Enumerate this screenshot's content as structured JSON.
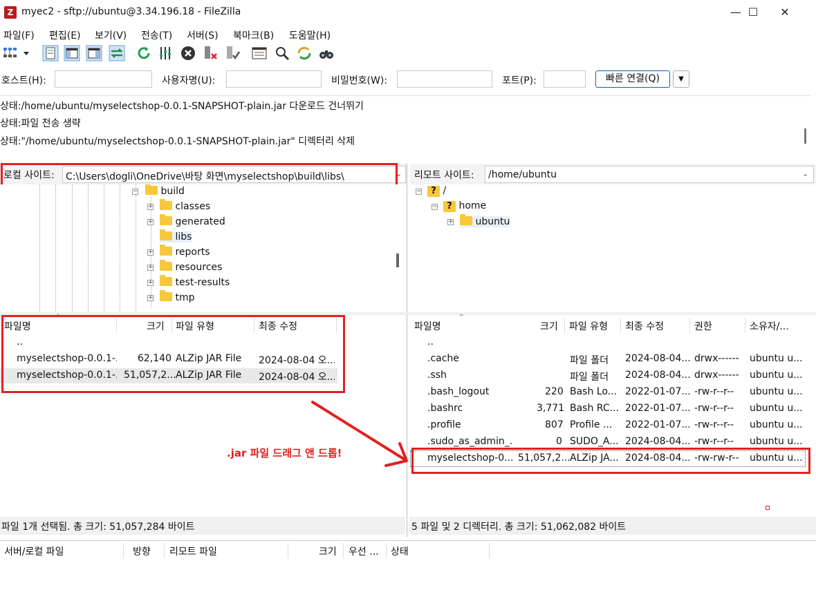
{
  "window": {
    "title": "myec2 - sftp://ubuntu@3.34.196.18 - FileZilla",
    "minimize": "—",
    "maximize": "☐",
    "close": "✕"
  },
  "menu": [
    "파일(F)",
    "편집(E)",
    "보기(V)",
    "전송(T)",
    "서버(S)",
    "북마크(B)",
    "도움말(H)"
  ],
  "quickconnect": {
    "host_label": "호스트(H):",
    "user_label": "사용자명(U):",
    "pass_label": "비밀번호(W):",
    "port_label": "포트(P):",
    "button": "빠른 연결(Q)"
  },
  "log": [
    "상태:/home/ubuntu/myselectshop-0.0.1-SNAPSHOT-plain.jar 다운로드 건너뛰기",
    "상태:파일 전송 생략",
    "상태:\"/home/ubuntu/myselectshop-0.0.1-SNAPSHOT-plain.jar\" 디렉터리 삭제"
  ],
  "local": {
    "label": "로컬 사이트:",
    "path": "C:\\Users\\dogli\\OneDrive\\바탕 화면\\myselectshop\\build\\libs\\",
    "tree_root": "build",
    "tree_children": [
      "classes",
      "generated",
      "libs",
      "reports",
      "resources",
      "test-results",
      "tmp"
    ],
    "headers": [
      "파일명",
      "크기",
      "파일 유형",
      "최종 수정"
    ],
    "files": [
      {
        "name": "..",
        "size": "",
        "type": "",
        "modified": ""
      },
      {
        "name": "myselectshop-0.0.1-...",
        "size": "62,140",
        "type": "ALZip JAR File",
        "modified": "2024-08-04 오..."
      },
      {
        "name": "myselectshop-0.0.1-...",
        "size": "51,057,2...",
        "type": "ALZip JAR File",
        "modified": "2024-08-04 오..."
      }
    ],
    "status": "파일 1개 선택됨. 총 크기: 51,057,284 바이트"
  },
  "remote": {
    "label": "리모트 사이트:",
    "path": "/home/ubuntu",
    "tree": [
      "/",
      "home",
      "ubuntu"
    ],
    "headers": [
      "파일명",
      "크기",
      "파일 유형",
      "최종 수정",
      "권한",
      "소유자/..."
    ],
    "files": [
      {
        "name": "..",
        "size": "",
        "type": "",
        "modified": "",
        "perm": "",
        "owner": ""
      },
      {
        "name": ".cache",
        "size": "",
        "type": "파일 폴더",
        "modified": "2024-08-04...",
        "perm": "drwx------",
        "owner": "ubuntu u..."
      },
      {
        "name": ".ssh",
        "size": "",
        "type": "파일 폴더",
        "modified": "2024-08-04...",
        "perm": "drwx------",
        "owner": "ubuntu u..."
      },
      {
        "name": ".bash_logout",
        "size": "220",
        "type": "Bash Lo...",
        "modified": "2022-01-07...",
        "perm": "-rw-r--r--",
        "owner": "ubuntu u..."
      },
      {
        "name": ".bashrc",
        "size": "3,771",
        "type": "Bash RC...",
        "modified": "2022-01-07...",
        "perm": "-rw-r--r--",
        "owner": "ubuntu u..."
      },
      {
        "name": ".profile",
        "size": "807",
        "type": "Profile ...",
        "modified": "2022-01-07...",
        "perm": "-rw-r--r--",
        "owner": "ubuntu u..."
      },
      {
        "name": ".sudo_as_admin_...",
        "size": "0",
        "type": "SUDO_A...",
        "modified": "2024-08-04...",
        "perm": "-rw-r--r--",
        "owner": "ubuntu u..."
      },
      {
        "name": "myselectshop-0....",
        "size": "51,057,2...",
        "type": "ALZip JA...",
        "modified": "2024-08-04...",
        "perm": "-rw-rw-r--",
        "owner": "ubuntu u..."
      }
    ],
    "status": "5 파일 및 2 디렉터리. 총 크기: 51,062,082 바이트"
  },
  "queue": {
    "headers": [
      "서버/로컬 파일",
      "방향",
      "리모트 파일",
      "크기",
      "우선 ...",
      "상태"
    ]
  },
  "annotation": {
    "text": ".jar 파일 드래그 앤 드롭!",
    "color": "#e02020"
  }
}
